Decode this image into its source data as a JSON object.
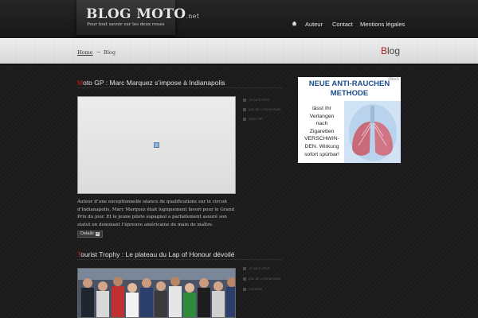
{
  "header": {
    "logo": {
      "title": "BLOG MOTO",
      "tld": ".net",
      "tagline": "Pour tout savoir sur les deux roues"
    },
    "nav": [
      {
        "label": "Auteur"
      },
      {
        "label": "Contact"
      },
      {
        "label": "Mentions légales"
      }
    ],
    "home_icon": "home-icon"
  },
  "banner": {
    "breadcrumb": {
      "home": "Home",
      "separator": "→",
      "current": "Blog"
    },
    "page_title": {
      "first": "B",
      "rest": "log"
    }
  },
  "posts": [
    {
      "title_first": "M",
      "title_rest": "oto GP : Marc Marquez s’impose à Indianapolis",
      "meta": [
        "18 août 2013",
        "pas de commentaire",
        "Moto GP"
      ],
      "excerpt": "Auteur d’une exceptionnelle séance de qualifications sur le circuit d’Indianapolis, Marc Marquez était logiquement favori pour le Grand Prix du jour. Et le jeune pilote espagnol a parfaitement assuré son statut en dominant l’épreuve américaine de main de maître.",
      "details_label": "Details"
    },
    {
      "title_first": "T",
      "title_rest": "ourist Trophy : Le plateau du Lap of Honour dévoilé",
      "meta": [
        "17 août 2013",
        "pas de commentaire",
        "Actualité"
      ]
    }
  ],
  "ad": {
    "headline_1": "NEUE ANTI-RAUCHEN",
    "headline_2": "METHODE",
    "body": [
      "lässt Ihr",
      "Verlangen",
      "nach",
      "Zigaretten",
      "VERSCHWIN-",
      "DEN. Wirkung",
      "sofort spürbar!"
    ],
    "corner": "iStock"
  },
  "colors": {
    "accent": "#c41c1c",
    "ad_blue": "#1b4e8a"
  }
}
